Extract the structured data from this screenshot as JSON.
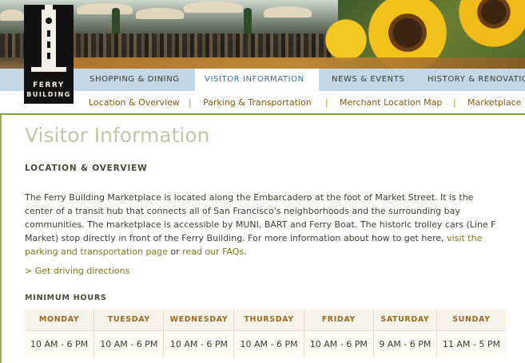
{
  "logo": {
    "line1": "FERRY",
    "line2": "BUILDING"
  },
  "nav": {
    "items": [
      {
        "label": "SHOPPING & DINING"
      },
      {
        "label": "VISITOR INFORMATION"
      },
      {
        "label": "NEWS & EVENTS"
      },
      {
        "label": "HISTORY & RENOVATIO"
      }
    ],
    "active_index": 1
  },
  "subnav": {
    "items": [
      {
        "label": "Location & Overview"
      },
      {
        "label": "Parking & Transportation"
      },
      {
        "label": "Merchant Location Map"
      },
      {
        "label": "Marketplace"
      }
    ],
    "separator": "|"
  },
  "page": {
    "title": "Visitor Information",
    "section_heading": "LOCATION & OVERVIEW",
    "body_text": "The Ferry Building Marketplace is located along the Embarcadero at the foot of Market Street. It is the center of a transit hub that connects all of San Francisco's neighborhoods and the surrounding bay communities. The marketplace is accessible by MUNI, BART and Ferry Boat. The historic trolley cars (Line F Market) stop directly in front of the Ferry Building. For more information about how to get here,",
    "link_parking": "visit the parking and transportation page",
    "link_or": " or ",
    "link_faqs": "read our FAQs",
    "link_end": ".",
    "directions_link": "> Get driving directions",
    "hours_heading": "MINIMUM HOURS"
  },
  "hours": {
    "days": [
      "MONDAY",
      "TUESDAY",
      "WEDNESDAY",
      "THURSDAY",
      "FRIDAY",
      "SATURDAY",
      "SUNDAY"
    ],
    "times": [
      "10 AM - 6 PM",
      "10 AM - 6 PM",
      "10 AM - 6 PM",
      "10 AM - 6 PM",
      "10 AM - 6 PM",
      "9 AM - 6 PM",
      "11 AM - 5 PM"
    ]
  },
  "colors": {
    "nav_bg": "#c3d7e7",
    "nav_active_text": "#3a6a9a",
    "subnav_link": "#8a5a10",
    "title": "#c2c6a8",
    "link": "#7a7a1a",
    "table_header_text": "#9a6a20"
  }
}
